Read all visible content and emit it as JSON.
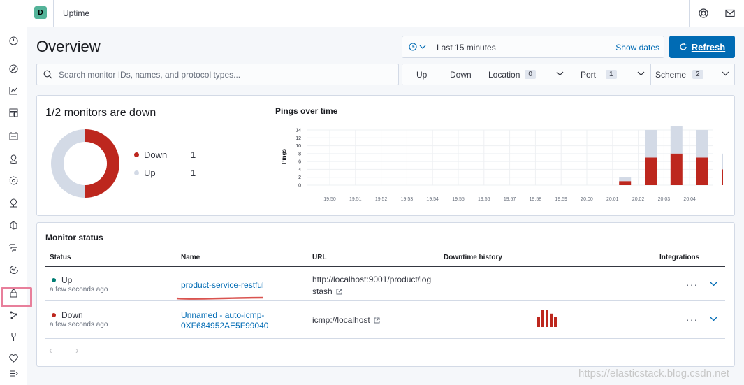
{
  "header": {
    "space_initial": "D",
    "app_title": "Uptime",
    "help_icon": "help-lifebuoy-icon",
    "mail_icon": "mail-icon"
  },
  "sidenav": {
    "icons": [
      "clock-icon",
      "compass-icon",
      "visualize-icon",
      "dashboard-icon",
      "canvas-icon",
      "maps-icon",
      "ml-icon",
      "metrics-icon",
      "logs-icon",
      "apm-icon",
      "uptime-icon",
      "siem-icon",
      "graph-icon",
      "devtools-icon",
      "monitoring-icon",
      "collapse-icon"
    ],
    "selected": "uptime-icon"
  },
  "page": {
    "title": "Overview",
    "date_range": "Last 15 minutes",
    "show_dates": "Show dates",
    "refresh": "Refresh",
    "search_placeholder": "Search monitor IDs, names, and protocol types..."
  },
  "filters": {
    "up": "Up",
    "down": "Down",
    "location": {
      "label": "Location",
      "count": "0"
    },
    "port": {
      "label": "Port",
      "count": "1"
    },
    "scheme": {
      "label": "Scheme",
      "count": "2"
    }
  },
  "snapshot": {
    "title": "1/2 monitors are down",
    "legend": [
      {
        "label": "Down",
        "count": "1",
        "color": "#bd271e"
      },
      {
        "label": "Up",
        "count": "1",
        "color": "#d3dae6"
      }
    ],
    "donut": {
      "down": 1,
      "up": 1
    }
  },
  "colors": {
    "down": "#bd271e",
    "up": "#d3dae6",
    "accent": "#006bb4",
    "healthy": "#017d73"
  },
  "chart_data": {
    "type": "bar",
    "title": "Pings over time",
    "ylabel": "Pings",
    "ylim": [
      0,
      14
    ],
    "yticks": [
      0,
      2,
      4,
      6,
      8,
      10,
      12,
      14
    ],
    "categories": [
      "19:50",
      "19:51",
      "19:52",
      "19:53",
      "19:54",
      "19:55",
      "19:56",
      "19:57",
      "19:58",
      "19:59",
      "20:00",
      "20:01",
      "20:02",
      "20:03",
      "20:04"
    ],
    "bars": [
      {
        "x": 20.01,
        "down": 1,
        "up": 1
      },
      {
        "x": 20.02,
        "down": 7,
        "up": 7
      },
      {
        "x": 20.03,
        "down": 8,
        "up": 7
      },
      {
        "x": 20.04,
        "down": 7,
        "up": 7
      },
      {
        "x": 20.05,
        "down": 4,
        "up": 4
      }
    ],
    "stacked": true,
    "series": [
      {
        "name": "Down",
        "color": "#bd271e"
      },
      {
        "name": "Up",
        "color": "#d3dae6"
      }
    ],
    "grid": true
  },
  "monitor_status": {
    "title": "Monitor status",
    "columns": [
      "Status",
      "Name",
      "URL",
      "Downtime history",
      "Integrations"
    ],
    "rows": [
      {
        "status": "Up",
        "status_color": "#017d73",
        "time": "a few seconds ago",
        "name": "product-service-restful",
        "url_line1": "http://localhost:9001/product/log",
        "url_line2": "stash",
        "history": []
      },
      {
        "status": "Down",
        "status_color": "#bd271e",
        "time": "a few seconds ago",
        "name_line1": "Unnamed - auto-icmp-",
        "name_line2": "0XF684952AE5F99040",
        "url_line1": "icmp://localhost",
        "history": [
          3,
          5,
          5,
          4,
          3
        ]
      }
    ]
  },
  "watermark": "https://elasticstack.blog.csdn.net"
}
